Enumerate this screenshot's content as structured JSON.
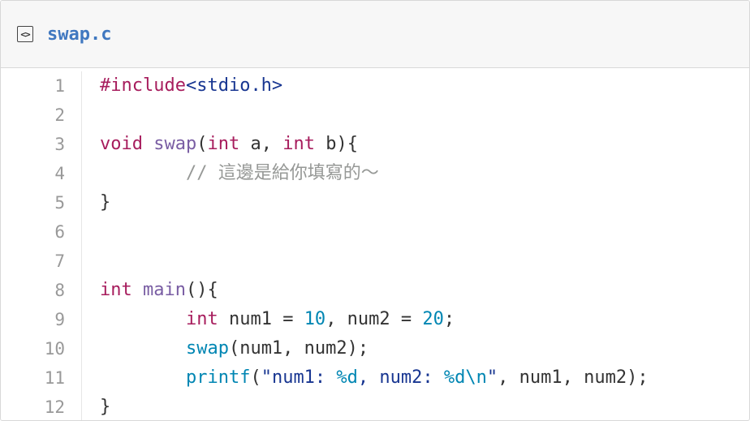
{
  "file": {
    "name": "swap.c",
    "icon": "code-file-icon",
    "icon_glyph": "<>"
  },
  "colors": {
    "keyword": "#a71d5d",
    "function": "#795da3",
    "constant": "#0086b3",
    "string": "#183691",
    "comment": "#969896",
    "plain": "#333333",
    "line_number": "#999999",
    "filename": "#4078c0"
  },
  "lines": [
    {
      "n": "1",
      "tokens": [
        [
          "kw",
          "#include"
        ],
        [
          "str",
          "<stdio.h>"
        ]
      ]
    },
    {
      "n": "2",
      "tokens": []
    },
    {
      "n": "3",
      "tokens": [
        [
          "kw",
          "void"
        ],
        [
          "pl",
          " "
        ],
        [
          "fn",
          "swap"
        ],
        [
          "pl",
          "("
        ],
        [
          "kw",
          "int"
        ],
        [
          "pl",
          " a, "
        ],
        [
          "kw",
          "int"
        ],
        [
          "pl",
          " b){"
        ]
      ]
    },
    {
      "n": "4",
      "tokens": [
        [
          "pl",
          "        "
        ],
        [
          "cm",
          "// 這邊是給你填寫的～"
        ]
      ]
    },
    {
      "n": "5",
      "tokens": [
        [
          "pl",
          "}"
        ]
      ]
    },
    {
      "n": "6",
      "tokens": []
    },
    {
      "n": "7",
      "tokens": []
    },
    {
      "n": "8",
      "tokens": [
        [
          "kw",
          "int"
        ],
        [
          "pl",
          " "
        ],
        [
          "fn",
          "main"
        ],
        [
          "pl",
          "(){"
        ]
      ]
    },
    {
      "n": "9",
      "tokens": [
        [
          "pl",
          "        "
        ],
        [
          "kw",
          "int"
        ],
        [
          "pl",
          " num1 = "
        ],
        [
          "ent",
          "10"
        ],
        [
          "pl",
          ", num2 = "
        ],
        [
          "ent",
          "20"
        ],
        [
          "pl",
          ";"
        ]
      ]
    },
    {
      "n": "10",
      "tokens": [
        [
          "pl",
          "        "
        ],
        [
          "ent",
          "swap"
        ],
        [
          "pl",
          "(num1, num2);"
        ]
      ]
    },
    {
      "n": "11",
      "tokens": [
        [
          "pl",
          "        "
        ],
        [
          "ent",
          "printf"
        ],
        [
          "pl",
          "("
        ],
        [
          "str",
          "\"num1: "
        ],
        [
          "ent",
          "%d"
        ],
        [
          "str",
          ", num2: "
        ],
        [
          "ent",
          "%d"
        ],
        [
          "ent",
          "\\n"
        ],
        [
          "str",
          "\""
        ],
        [
          "pl",
          ", num1, num2);"
        ]
      ]
    },
    {
      "n": "12",
      "tokens": [
        [
          "pl",
          "}"
        ]
      ]
    }
  ]
}
